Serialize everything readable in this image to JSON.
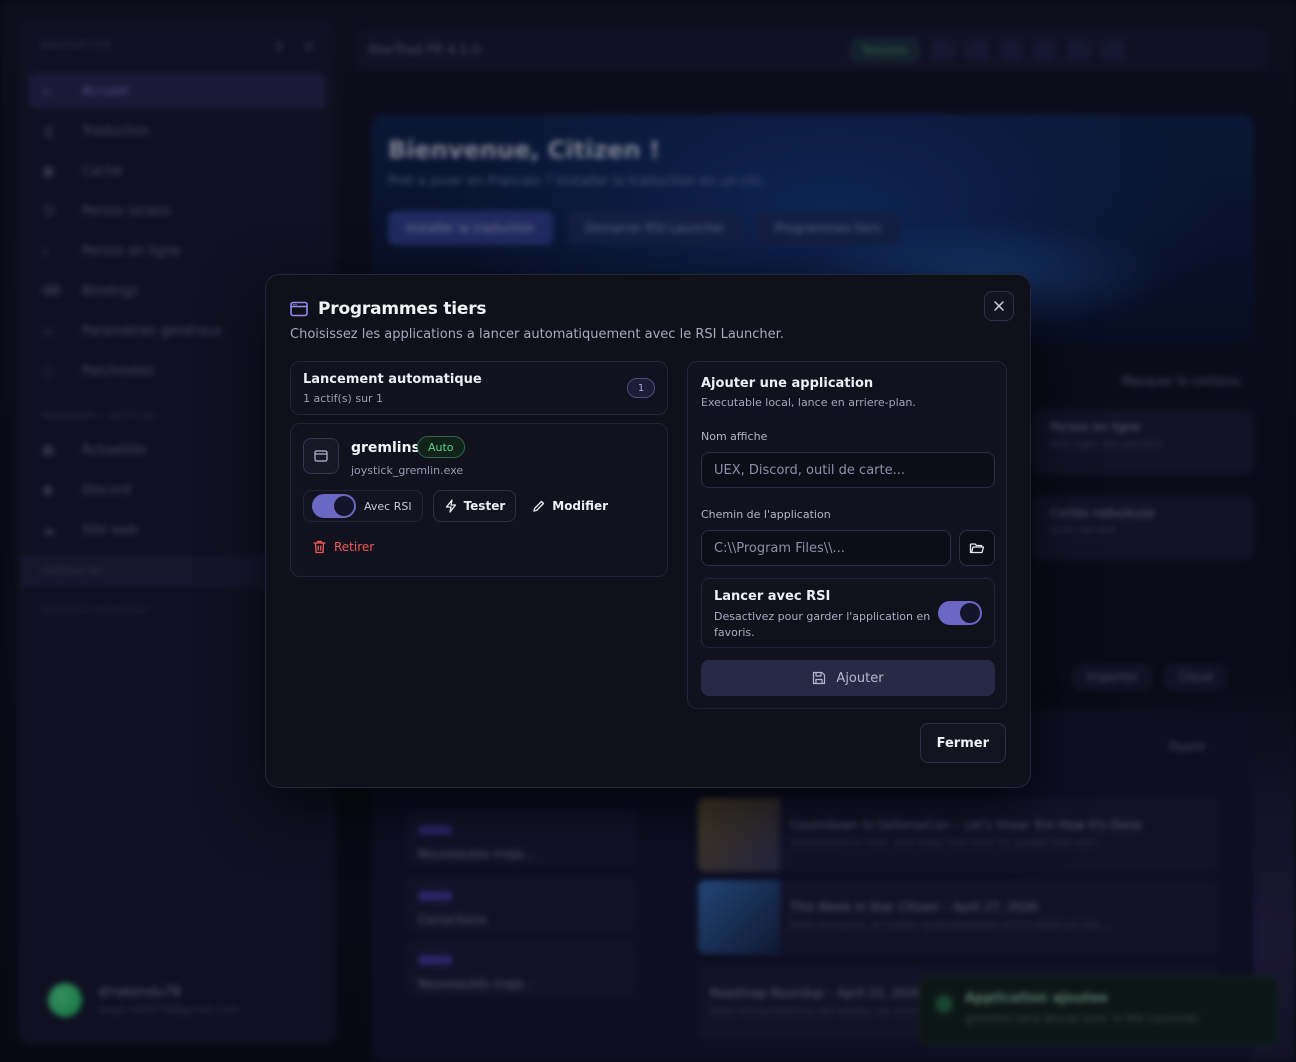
{
  "background": {
    "sidebar": {
      "header": "NAVIGATION",
      "items": [
        {
          "label": "Accueil",
          "icon": "home-icon"
        },
        {
          "label": "Traduction",
          "icon": "translate-icon"
        },
        {
          "label": "Cache",
          "icon": "box-icon"
        },
        {
          "label": "Persos locaux",
          "icon": "user-icon"
        },
        {
          "label": "Persos en ligne",
          "icon": "download-icon"
        },
        {
          "label": "Bindings",
          "icon": "keyboard-icon"
        },
        {
          "label": "Paramètres généraux",
          "icon": "monitor-icon"
        },
        {
          "label": "Patchnotes",
          "icon": "chat-icon"
        }
      ],
      "section_social": "RÉSEAUX / ACTU SC",
      "social_items": [
        {
          "label": "Actualités",
          "icon": "grid-icon"
        },
        {
          "label": "Discord",
          "icon": "discord-icon"
        },
        {
          "label": "Site web",
          "icon": "cloud-icon"
        }
      ],
      "section_tools": "OUTILS SC",
      "section_external": "Services Externes",
      "user_name": "drrakendu78",
      "user_email": "ange.noire78@gmail.com"
    },
    "topbar": {
      "title": "StarTrad FR 4.1.0",
      "status": "Tentions"
    },
    "hero": {
      "title": "Bienvenue, Citizen !",
      "subtitle": "Pret a jouer en Francais ? Installer la traduction en un clic.",
      "btn_install": "Installer la traduction",
      "btn_launch": "Demarrer RSI Launcher",
      "btn_third": "Programmes tiers"
    },
    "hide_content": "Masquer le contenu",
    "cards": [
      {
        "title": "Persos en ligne",
        "desc": "Wiki login des personn"
      },
      {
        "title": "Cortes nebuleuse",
        "desc": "Nuos abrutes"
      }
    ],
    "actions": [
      "Importer",
      "Cloud"
    ],
    "news": {
      "open": "Ouvrir",
      "left": [
        "Nouveautes maje...",
        "Corrections",
        "Nouveautés maje..."
      ],
      "right": [
        {
          "title": "Countdown to DefenseCon – Let's Show 'Em How It's Done",
          "desc": "DefenseCon is here, with ships that work for people that wor..."
        },
        {
          "title": "This Week in Star Citizen – April 27, 2026",
          "desc": "Hello everyone, et todam nyaltyandAlpha 4.7.2 rolled out last..."
        },
        {
          "title": "Roadmap Roundup – April 22, 2026",
          "desc": "Hello everyoneEvery two weeks, we accel..."
        }
      ]
    },
    "toast": {
      "title": "Application ajoutee",
      "desc": "gremlins sera lancee avec le RSI Launcher."
    }
  },
  "modal": {
    "title": "Programmes tiers",
    "subtitle": "Choisissez les applications a lancer automatiquement avec le RSI Launcher.",
    "auto_launch": {
      "title": "Lancement automatique",
      "summary": "1 actif(s) sur 1",
      "count": "1"
    },
    "app": {
      "name": "gremlins",
      "badge": "Auto",
      "exe": "joystick_gremlin.exe",
      "toggle_label": "Avec RSI",
      "toggle_on": true,
      "test_label": "Tester",
      "edit_label": "Modifier",
      "remove_label": "Retirer"
    },
    "add_form": {
      "title": "Ajouter une application",
      "subtitle": "Executable local, lance en arriere-plan.",
      "name_label": "Nom affiche",
      "name_placeholder": "UEX, Discord, outil de carte...",
      "path_label": "Chemin de l'application",
      "path_placeholder": "C:\\\\Program Files\\\\...",
      "launch_title": "Lancer avec RSI",
      "launch_desc": "Desactivez pour garder l'application en favoris.",
      "launch_on": true,
      "add_label": "Ajouter"
    },
    "close_label": "Fermer"
  },
  "colors": {
    "accent": "#6a68c4",
    "success": "#56d18a",
    "danger": "#ef5b5b",
    "modal_bg": "#0f1019"
  }
}
